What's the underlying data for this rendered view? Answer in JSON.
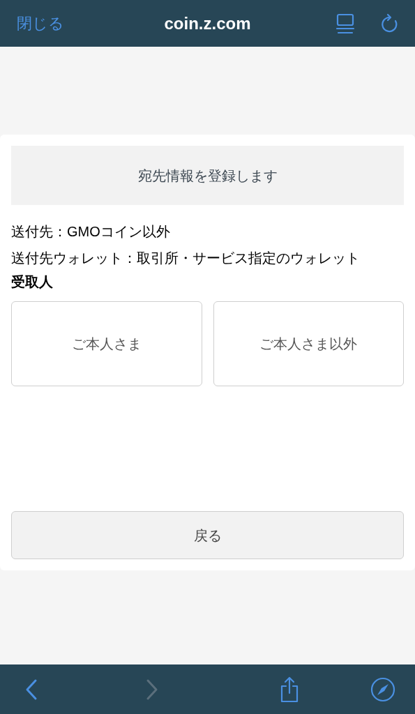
{
  "header": {
    "close": "閉じる",
    "title": "coin.z.com"
  },
  "banner": "宛先情報を登録します",
  "details": [
    "送付先：GMOコイン以外",
    "送付先ウォレット：取引所・サービス指定のウォレット"
  ],
  "recipient_label": "受取人",
  "choices": [
    {
      "label": "ご本人さま"
    },
    {
      "label": "ご本人さま以外"
    }
  ],
  "back_button": "戻る",
  "toolbar": {
    "back_disabled": false,
    "forward_disabled": true
  }
}
